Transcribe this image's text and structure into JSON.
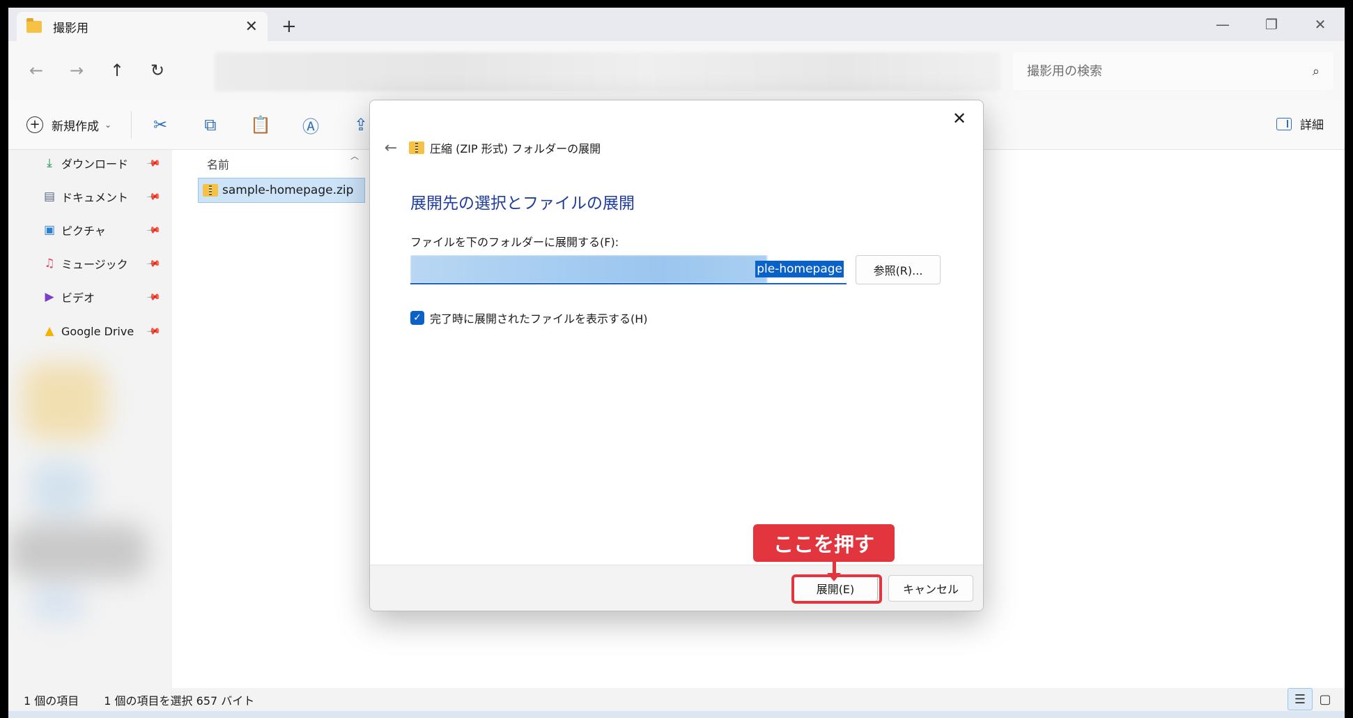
{
  "window": {
    "tab_title": "撮影用",
    "new_tab": "+",
    "minimize": "—",
    "maximize": "❐",
    "close": "✕"
  },
  "nav": {
    "back": "←",
    "forward": "→",
    "up": "↑",
    "refresh": "↻",
    "search_placeholder": "撮影用の検索"
  },
  "toolbar": {
    "new_label": "新規作成",
    "details_label": "詳細"
  },
  "sidebar": {
    "items": [
      {
        "label": "ダウンロード",
        "icon": "download-icon"
      },
      {
        "label": "ドキュメント",
        "icon": "document-icon"
      },
      {
        "label": "ピクチャ",
        "icon": "pictures-icon"
      },
      {
        "label": "ミュージック",
        "icon": "music-icon"
      },
      {
        "label": "ビデオ",
        "icon": "video-icon"
      },
      {
        "label": "Google Drive",
        "icon": "google-drive-icon"
      }
    ]
  },
  "filelist": {
    "column_name": "名前",
    "files": [
      {
        "name": "sample-homepage.zip",
        "selected": true
      }
    ]
  },
  "status": {
    "item_count": "1 個の項目",
    "selection": "1 個の項目を選択  657 バイト"
  },
  "dialog": {
    "caption": "圧縮 (ZIP 形式) フォルダーの展開",
    "heading": "展開先の選択とファイルの展開",
    "path_label": "ファイルを下のフォルダーに展開する(F):",
    "path_visible": "ple-homepage",
    "browse_label": "参照(R)...",
    "checkbox_label": "完了時に展開されたファイルを表示する(H)",
    "checkbox_checked": true,
    "extract_label": "展開(E)",
    "cancel_label": "キャンセル"
  },
  "annotation": {
    "callout_text": "ここを押す",
    "color": "#e2353d"
  },
  "colors": {
    "accent": "#0a62c9",
    "heading": "#1e3d9b",
    "selection_bg": "#cce3f8"
  }
}
